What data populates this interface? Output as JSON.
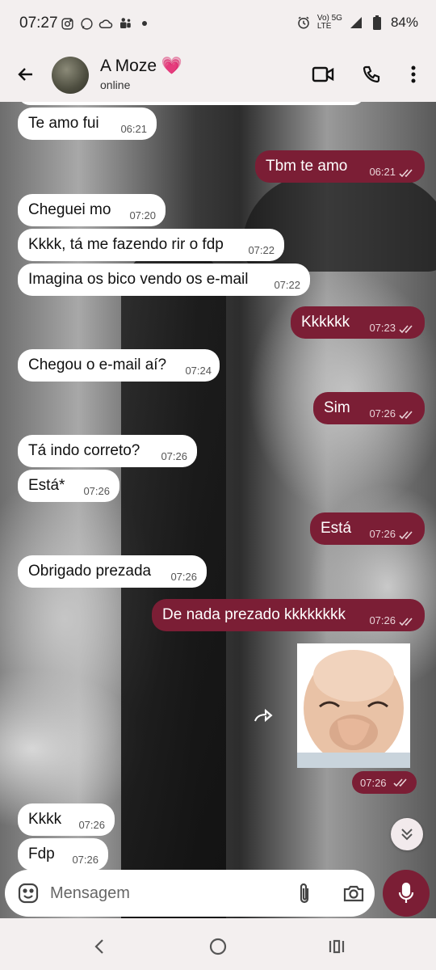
{
  "status_bar": {
    "time": "07:27",
    "network_top": "Vo) 5G",
    "network_bottom": "LTE",
    "battery": "84%"
  },
  "header": {
    "contact_name": "A Moze 💗",
    "contact_status": "online"
  },
  "messages": [
    {
      "text": "Te amo fui",
      "time": "06:21"
    },
    {
      "text": "Tbm te amo",
      "time": "06:21"
    },
    {
      "text": "Cheguei mo",
      "time": "07:20"
    },
    {
      "text": "Kkkk, tá me fazendo rir o fdp",
      "time": "07:22"
    },
    {
      "text": "Imagina os bico vendo os e-mail",
      "time": "07:22"
    },
    {
      "text": "Kkkkkk",
      "time": "07:23"
    },
    {
      "text": "Chegou o e-mail aí?",
      "time": "07:24"
    },
    {
      "text": "Sim",
      "time": "07:26"
    },
    {
      "text": "Tá indo correto?",
      "time": "07:26"
    },
    {
      "text": "Está*",
      "time": "07:26"
    },
    {
      "text": "Está",
      "time": "07:26"
    },
    {
      "text": "Obrigado prezada",
      "time": "07:26"
    },
    {
      "text": "De nada prezado kkkkkkkk",
      "time": "07:26"
    },
    {
      "text": "Kkkk",
      "time": "07:26"
    },
    {
      "text": "Fdp",
      "time": "07:26"
    }
  ],
  "sticker": {
    "time": "07:26"
  },
  "composer": {
    "placeholder": "Mensagem"
  },
  "colors": {
    "accent": "#7b1e35",
    "incoming_bubble": "#ffffff",
    "background": "#f3efef"
  },
  "icons": [
    "back-arrow-icon",
    "video-call-icon",
    "phone-icon",
    "more-vert-icon",
    "double-check-icon",
    "forward-icon",
    "chevron-double-down-icon",
    "emoji-icon",
    "attach-icon",
    "camera-icon",
    "mic-icon",
    "nav-back-icon",
    "nav-home-icon",
    "nav-recents-icon"
  ]
}
